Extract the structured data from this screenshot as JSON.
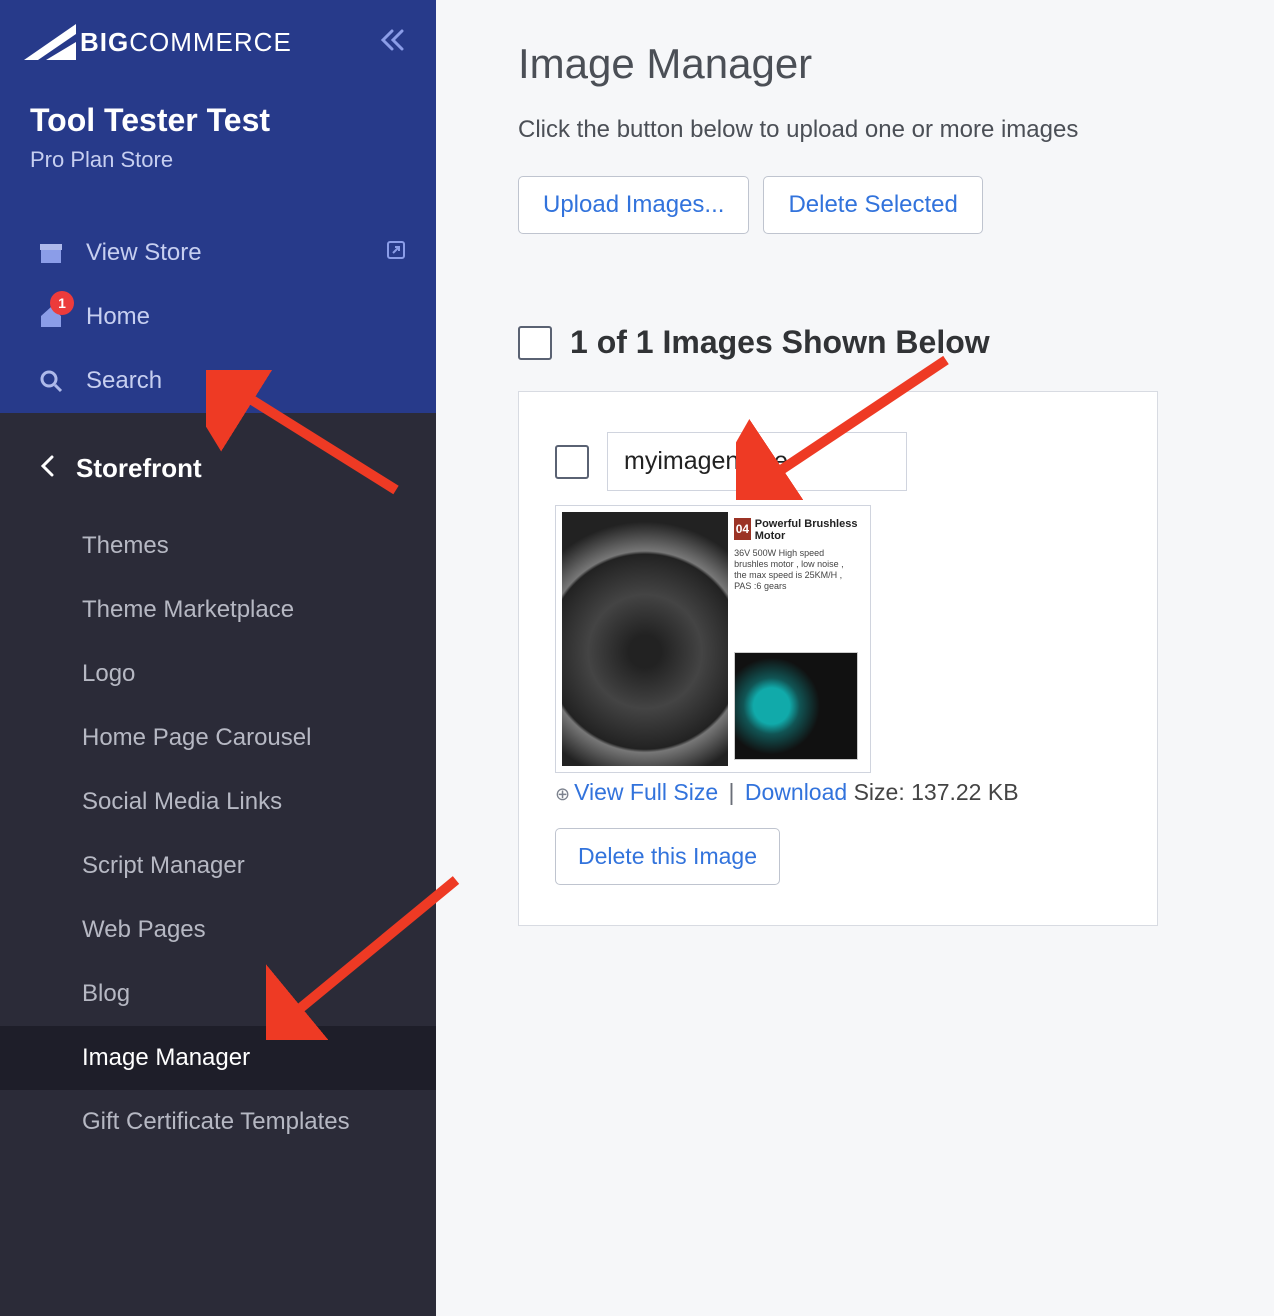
{
  "brand": {
    "bold": "BIG",
    "rest": "COMMERCE"
  },
  "store": {
    "name": "Tool Tester Test",
    "plan": "Pro Plan Store"
  },
  "nav": {
    "view_store": "View Store",
    "home": "Home",
    "home_badge": "1",
    "search": "Search"
  },
  "submenu": {
    "title": "Storefront",
    "items": [
      "Themes",
      "Theme Marketplace",
      "Logo",
      "Home Page Carousel",
      "Social Media Links",
      "Script Manager",
      "Web Pages",
      "Blog",
      "Image Manager",
      "Gift Certificate Templates"
    ],
    "active_index": 8
  },
  "page": {
    "title": "Image Manager",
    "desc": "Click the button below to upload one or more images",
    "upload_btn": "Upload Images...",
    "delete_sel_btn": "Delete Selected",
    "list_title": "1 of 1 Images Shown Below"
  },
  "image": {
    "name": "myimagename",
    "thumb_tag": "04",
    "thumb_title": "Powerful Brushless Motor",
    "thumb_desc": "36V 500W High speed brushles motor , low noise , the max speed is 25KM/H , PAS :6 gears",
    "view_link": "View Full Size",
    "download_link": "Download",
    "size_label": "Size:",
    "size_value": "137.22 KB",
    "delete_btn": "Delete this Image"
  }
}
